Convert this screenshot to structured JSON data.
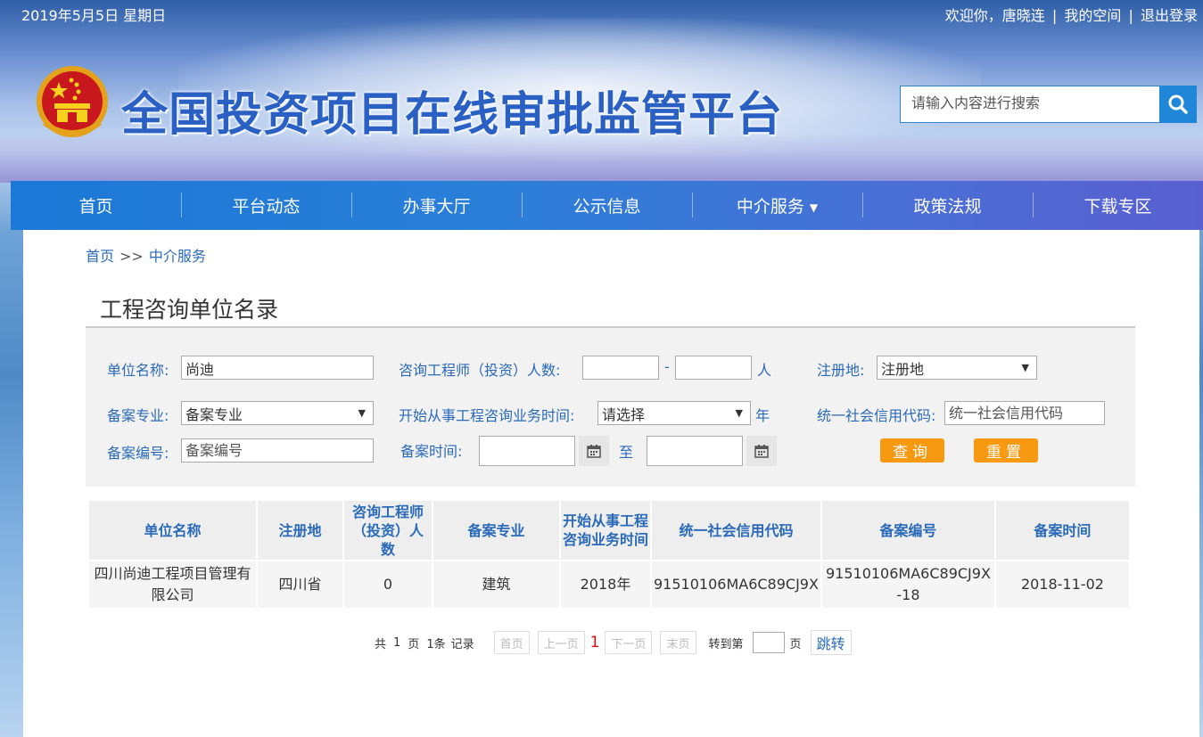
{
  "header": {
    "date": "2019年5月5日 星期日",
    "welcome": "欢迎你，唐晓连",
    "link_space": "我的空间",
    "link_logout": "退出登录",
    "link_sep": "|",
    "site_title": "全国投资项目在线审批监管平台",
    "search_placeholder": "请输入内容进行搜索"
  },
  "nav": {
    "items": [
      {
        "label": "首页"
      },
      {
        "label": "平台动态"
      },
      {
        "label": "办事大厅"
      },
      {
        "label": "公示信息"
      },
      {
        "label": "中介服务",
        "caret": "▼"
      },
      {
        "label": "政策法规"
      },
      {
        "label": "下载专区"
      }
    ]
  },
  "breadcrumb": {
    "home": "首页",
    "sep": ">>",
    "current": "中介服务"
  },
  "page_title": "工程咨询单位名录",
  "filter": {
    "unit_name_label": "单位名称:",
    "unit_name_value": "尚迪",
    "engineer_count_label": "咨询工程师（投资）人数:",
    "range_dash": "-",
    "unit_person": "人",
    "region_label": "注册地:",
    "region_value": "注册地",
    "specialty_label": "备案专业:",
    "specialty_value": "备案专业",
    "start_time_label": "开始从事工程咨询业务时间:",
    "start_time_value": "请选择",
    "unit_year": "年",
    "credit_code_label": "统一社会信用代码:",
    "credit_code_placeholder": "统一社会信用代码",
    "record_no_label": "备案编号:",
    "record_no_placeholder": "备案编号",
    "record_time_label": "备案时间:",
    "to_label": "至",
    "query_button": "查询",
    "reset_button": "重置"
  },
  "table": {
    "headers": [
      "单位名称",
      "注册地",
      "咨询工程师（投资）人数",
      "备案专业",
      "开始从事工程咨询业务时间",
      "统一社会信用代码",
      "备案编号",
      "备案时间"
    ],
    "rows": [
      [
        "四川尚迪工程项目管理有限公司",
        "四川省",
        "0",
        "建筑",
        "2018年",
        "91510106MA6C89CJ9X",
        "91510106MA6C89CJ9X-18",
        "2018-11-02"
      ]
    ]
  },
  "pager": {
    "total_prefix": "共",
    "total_pages": "1",
    "page_word": "页",
    "total_records": "1条",
    "records_word": "记录",
    "first": "首页",
    "prev": "上一页",
    "current": "1",
    "next": "下一页",
    "last": "末页",
    "goto_prefix": "转到第",
    "goto_suffix": "页",
    "go": "跳转"
  }
}
